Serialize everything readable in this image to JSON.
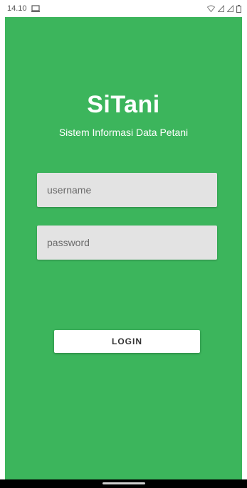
{
  "status_bar": {
    "time": "14.10",
    "icons": [
      "cast-icon",
      "wifi-icon",
      "signal-icon",
      "signal-icon",
      "battery-icon"
    ]
  },
  "app": {
    "title": "SiTani",
    "subtitle": "Sistem Informasi Data Petani",
    "background_color": "#3cb55c",
    "username": {
      "placeholder": "username",
      "value": ""
    },
    "password": {
      "placeholder": "password",
      "value": ""
    },
    "login_label": "LOGIN"
  }
}
